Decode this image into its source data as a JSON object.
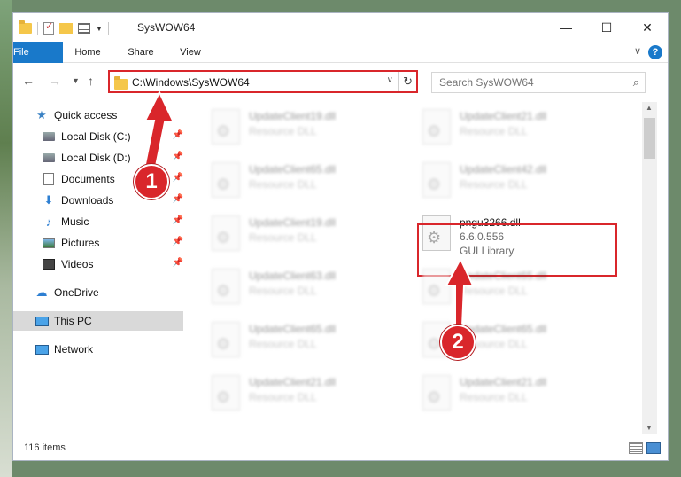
{
  "window": {
    "title": "SysWOW64",
    "minimize": "—",
    "maximize": "☐",
    "close": "✕"
  },
  "ribbon": {
    "file": "File",
    "home": "Home",
    "share": "Share",
    "view": "View",
    "expand": "∨",
    "help": "?"
  },
  "address": {
    "path": "C:\\Windows\\SysWOW64",
    "search_placeholder": "Search SysWOW64"
  },
  "sidebar": {
    "items": [
      {
        "label": "Quick access",
        "icon": "star-icon",
        "pinned": false
      },
      {
        "label": "Local Disk (C:)",
        "icon": "drive-icon",
        "pinned": true
      },
      {
        "label": "Local Disk (D:)",
        "icon": "drive-icon",
        "pinned": true
      },
      {
        "label": "Documents",
        "icon": "document-icon",
        "pinned": true
      },
      {
        "label": "Downloads",
        "icon": "download-icon",
        "pinned": true
      },
      {
        "label": "Music",
        "icon": "music-icon",
        "pinned": true
      },
      {
        "label": "Pictures",
        "icon": "pictures-icon",
        "pinned": true
      },
      {
        "label": "Videos",
        "icon": "videos-icon",
        "pinned": true
      },
      {
        "label": "OneDrive",
        "icon": "cloud-icon",
        "pinned": false
      },
      {
        "label": "This PC",
        "icon": "computer-icon",
        "pinned": false,
        "selected": true
      },
      {
        "label": "Network",
        "icon": "network-icon",
        "pinned": false
      }
    ]
  },
  "files": [
    {
      "name": "UpdateClient19.dll",
      "type": "Resource DLL"
    },
    {
      "name": "UpdateClient21.dll",
      "type": "Resource DLL"
    },
    {
      "name": "UpdateClient65.dll",
      "type": "Resource DLL"
    },
    {
      "name": "UpdateClient42.dll",
      "type": "Resource DLL"
    },
    {
      "name": "UpdateClient19.dll",
      "type": "Resource DLL"
    },
    {
      "name": "pngu3266.dll",
      "version": "6.6.0.556",
      "type": "GUI Library"
    },
    {
      "name": "UpdateClient63.dll",
      "type": "Resource DLL"
    },
    {
      "name": "UpdateClient65.dll",
      "type": "Resource DLL"
    },
    {
      "name": "UpdateClient65.dll",
      "type": "Resource DLL"
    },
    {
      "name": "UpdateClient65.dll",
      "type": "Resource DLL"
    },
    {
      "name": "UpdateClient21.dll",
      "type": "Resource DLL"
    },
    {
      "name": "UpdateClient21.dll",
      "type": "Resource DLL"
    }
  ],
  "status": {
    "item_count": "116 items"
  },
  "annotations": {
    "badge1": "1",
    "badge2": "2",
    "color": "#d9262b"
  }
}
